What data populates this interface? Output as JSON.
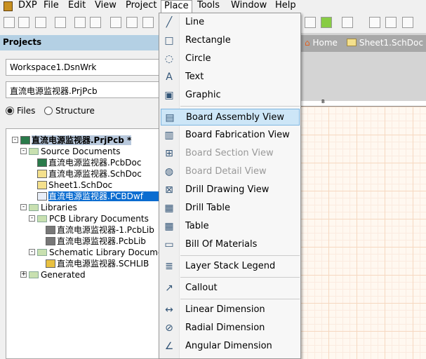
{
  "menubar": [
    "DXP",
    "File",
    "Edit",
    "View",
    "Project",
    "Place",
    "Tools",
    "Window",
    "Help"
  ],
  "projects_panel": {
    "title": "Projects",
    "workspace": "Workspace1.DsnWrk",
    "project": "直流电源监视器.PrjPcb",
    "radio_files": "Files",
    "radio_structure": "Structure",
    "selected_view": "Files"
  },
  "tree": [
    {
      "label": "直流电源监视器.PrjPcb *",
      "level": 0,
      "icon": "project-icon",
      "expander": "-",
      "bold": true
    },
    {
      "label": "Source Documents",
      "level": 1,
      "icon": "folder-icon",
      "expander": "-"
    },
    {
      "label": "直流电源监视器.PcbDoc",
      "level": 2,
      "icon": "pcb-doc-icon"
    },
    {
      "label": "直流电源监视器.SchDoc",
      "level": 2,
      "icon": "sch-doc-icon"
    },
    {
      "label": "Sheet1.SchDoc",
      "level": 2,
      "icon": "sch-doc-icon"
    },
    {
      "label": "直流电源监视器.PCBDwf",
      "level": 2,
      "icon": "draftsman-icon",
      "selected": true
    },
    {
      "label": "Libraries",
      "level": 1,
      "icon": "folder-icon",
      "expander": "-"
    },
    {
      "label": "PCB Library Documents",
      "level": 2,
      "icon": "folder-icon",
      "expander": "-"
    },
    {
      "label": "直流电源监视器-1.PcbLib",
      "level": 3,
      "icon": "pcblib-icon"
    },
    {
      "label": "直流电源监视器.PcbLib",
      "level": 3,
      "icon": "pcblib-icon"
    },
    {
      "label": "Schematic Library Documents",
      "level": 2,
      "icon": "folder-icon",
      "expander": "-"
    },
    {
      "label": "直流电源监视器.SCHLIB",
      "level": 3,
      "icon": "schlib-icon"
    },
    {
      "label": "Generated",
      "level": 1,
      "icon": "folder-icon",
      "expander": "+"
    }
  ],
  "doc_tabs": [
    "Home",
    "Sheet1.SchDoc"
  ],
  "ruler_label": "B",
  "place_menu": [
    {
      "label": "Line",
      "icon": "line-icon"
    },
    {
      "label": "Rectangle",
      "icon": "rectangle-icon"
    },
    {
      "label": "Circle",
      "icon": "circle-icon"
    },
    {
      "label": "Text",
      "icon": "text-icon"
    },
    {
      "label": "Graphic",
      "icon": "graphic-icon"
    },
    {
      "label": "Board Assembly View",
      "icon": "board-assembly-icon",
      "highlighted": true
    },
    {
      "label": "Board Fabrication View",
      "icon": "board-fabrication-icon"
    },
    {
      "label": "Board Section View",
      "icon": "board-section-icon",
      "disabled": true
    },
    {
      "label": "Board Detail View",
      "icon": "board-detail-icon",
      "disabled": true
    },
    {
      "label": "Drill Drawing View",
      "icon": "drill-drawing-icon"
    },
    {
      "label": "Drill Table",
      "icon": "drill-table-icon"
    },
    {
      "label": "Table",
      "icon": "table-icon"
    },
    {
      "label": "Bill Of Materials",
      "icon": "bom-icon"
    },
    {
      "label": "Layer Stack Legend",
      "icon": "layer-stack-icon"
    },
    {
      "label": "Callout",
      "icon": "callout-icon"
    },
    {
      "label": "Linear Dimension",
      "icon": "linear-dimension-icon"
    },
    {
      "label": "Radial Dimension",
      "icon": "radial-dimension-icon"
    },
    {
      "label": "Angular Dimension",
      "icon": "angular-dimension-icon"
    }
  ]
}
